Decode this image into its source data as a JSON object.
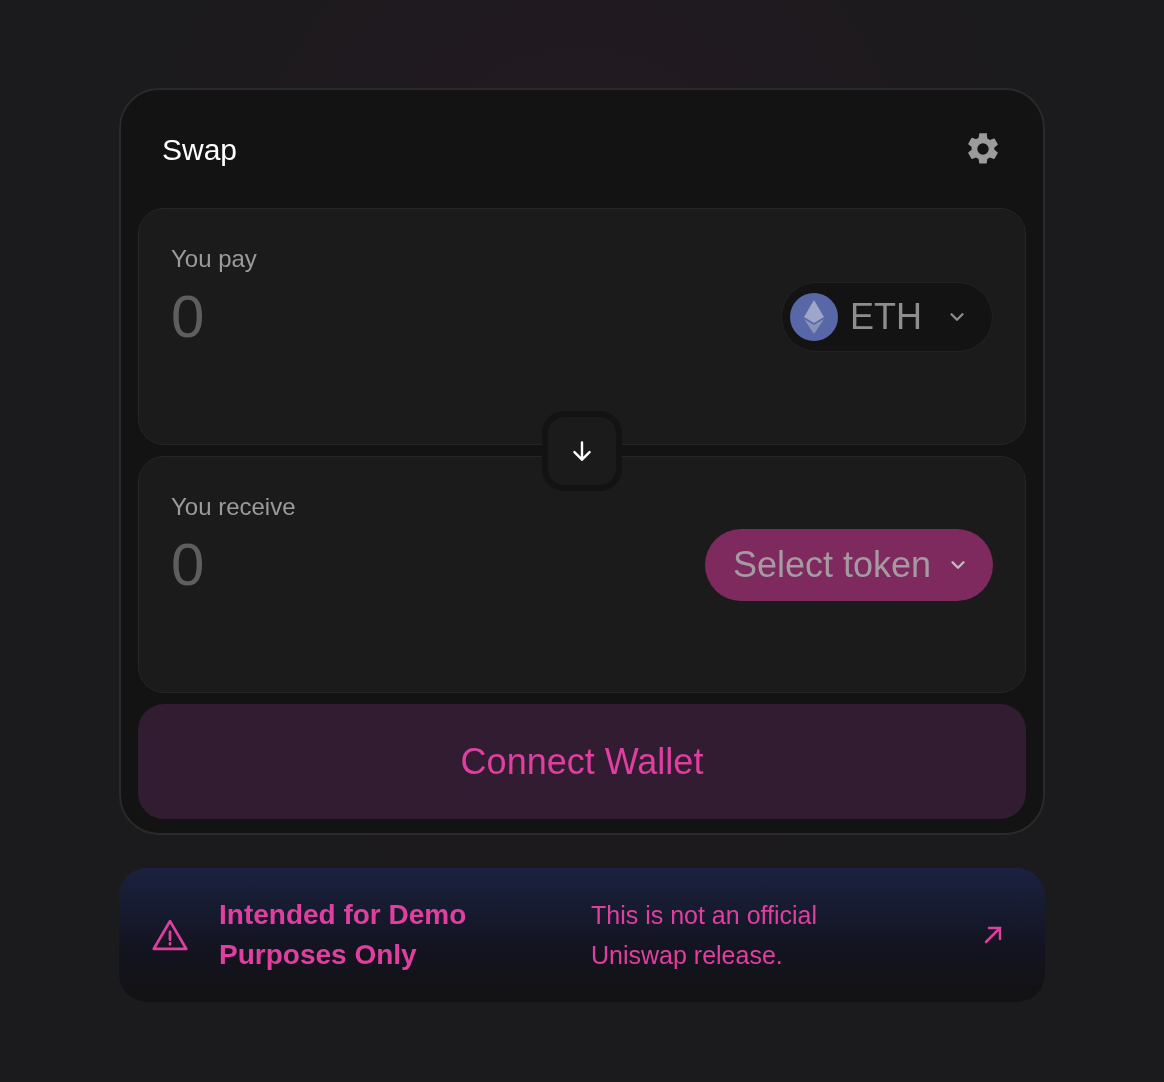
{
  "card": {
    "title": "Swap"
  },
  "panels": [
    {
      "label": "You pay",
      "placeholder": "0",
      "token": {
        "kind": "token",
        "label": "ETH"
      }
    },
    {
      "label": "You receive",
      "placeholder": "0",
      "token": {
        "kind": "select",
        "label": "Select token"
      }
    }
  ],
  "connect_button": "Connect Wallet",
  "banner": {
    "title": "Intended for Demo Purposes Only",
    "message": "This is not an official Uniswap release."
  }
}
